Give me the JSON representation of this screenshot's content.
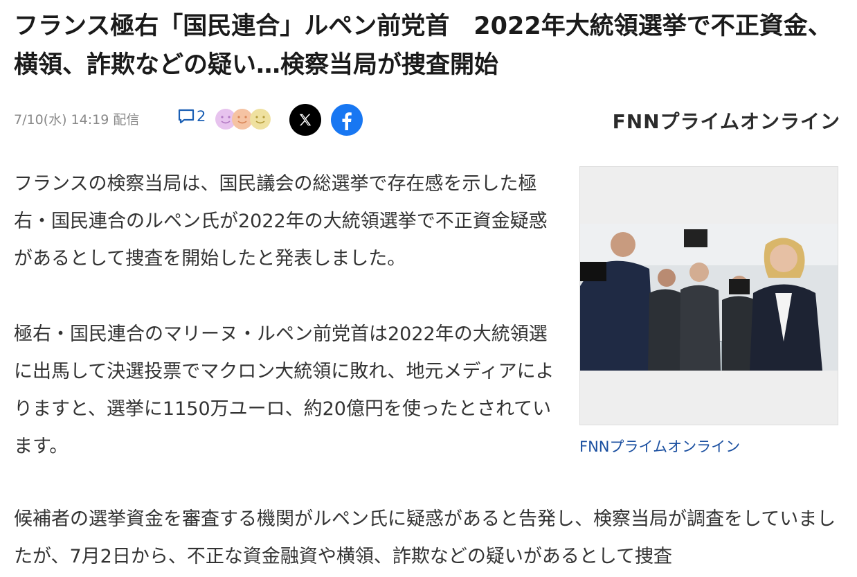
{
  "article": {
    "headline": "フランス極右「国民連合」ルペン前党首　2022年大統領選挙で不正資金、横領、詐欺などの疑い…検察当局が捜査開始",
    "date": "7/10(水) 14:19 配信",
    "comment_count": "2",
    "source_logo": "FNNプライムオンライン",
    "paragraphs": [
      "フランスの検察当局は、国民議会の総選挙で存在感を示した極右・国民連合のルペン氏が2022年の大統領選挙で不正資金疑惑があるとして捜査を開始したと発表しました。",
      "極右・国民連合のマリーヌ・ルペン前党首は2022年の大統領選に出馬して決選投票でマクロン大統領に敗れ、地元メディアによりますと、選挙に1150万ユーロ、約20億円を使ったとされています。",
      "候補者の選挙資金を審査する機関がルペン氏に疑惑があると告発し、検察当局が調査をしていましたが、7月2日から、不正な資金融資や横領、詐欺などの疑いがあるとして捜査"
    ],
    "photo_caption": "FNNプライムオンライン"
  },
  "icons": {
    "comment": "comment-bubble-icon",
    "x": "x-logo-icon",
    "facebook": "facebook-logo-icon"
  },
  "colors": {
    "link": "#1a5fb4",
    "facebook": "#1877f2",
    "x": "#000000",
    "logo_dot": "#e8382f"
  }
}
